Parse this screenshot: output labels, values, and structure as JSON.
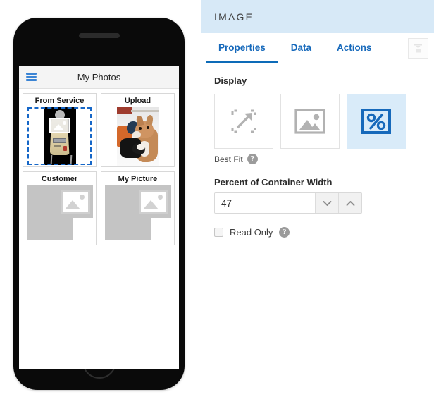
{
  "preview": {
    "device": "phone-mockup",
    "app_bar": {
      "menu_icon": "hamburger-icon",
      "title": "My Photos"
    },
    "cards": [
      {
        "title": "From Service",
        "thumb": "service-machine-photo",
        "selected": true
      },
      {
        "title": "Upload",
        "thumb": "corgi-puppy-photo",
        "selected": false
      },
      {
        "title": "Customer",
        "thumb": "image-placeholder",
        "selected": false
      },
      {
        "title": "My Picture",
        "thumb": "image-placeholder",
        "selected": false
      }
    ]
  },
  "panel": {
    "header_title": "IMAGE",
    "header_bg": "#d7e9f7",
    "accent": "#1669bb",
    "tabs": [
      {
        "label": "Properties",
        "active": true
      },
      {
        "label": "Data",
        "active": false
      },
      {
        "label": "Actions",
        "active": false
      }
    ],
    "panel_toggle_icon": "dock-panel-icon",
    "display": {
      "label": "Display",
      "options": [
        {
          "icon": "best-fit-expand-icon",
          "selected": false
        },
        {
          "icon": "original-size-image-icon",
          "selected": false
        },
        {
          "icon": "percent-image-icon",
          "selected": true
        }
      ],
      "helper_text": "Best Fit",
      "help_icon": "question-mark-icon",
      "help_glyph": "?"
    },
    "percent_field": {
      "label": "Percent of Container Width",
      "value": "47",
      "placeholder": "",
      "decrement_icon": "chevron-down-icon",
      "increment_icon": "chevron-up-icon"
    },
    "read_only": {
      "label": "Read Only",
      "checked": false,
      "help_icon": "question-mark-icon",
      "help_glyph": "?"
    }
  }
}
